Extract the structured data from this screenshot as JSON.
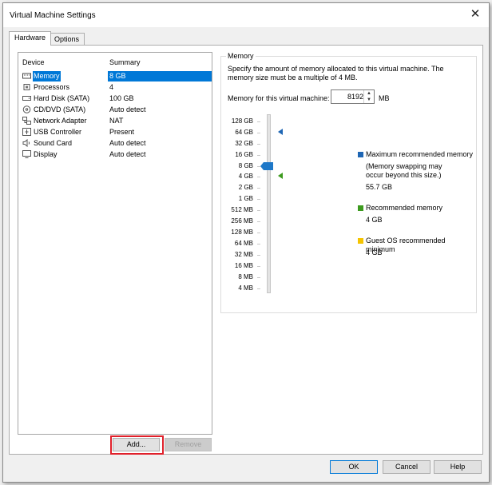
{
  "window": {
    "title": "Virtual Machine Settings",
    "close_glyph": "✕"
  },
  "tabs": [
    {
      "label": "Hardware"
    },
    {
      "label": "Options"
    }
  ],
  "device_list": {
    "headers": {
      "device": "Device",
      "summary": "Summary"
    },
    "rows": [
      {
        "icon": "memory-icon",
        "name": "Memory",
        "summary": "8 GB"
      },
      {
        "icon": "processor-icon",
        "name": "Processors",
        "summary": "4"
      },
      {
        "icon": "hard-disk-icon",
        "name": "Hard Disk (SATA)",
        "summary": "100 GB"
      },
      {
        "icon": "cd-dvd-icon",
        "name": "CD/DVD (SATA)",
        "summary": "Auto detect"
      },
      {
        "icon": "network-adapter-icon",
        "name": "Network Adapter",
        "summary": "NAT"
      },
      {
        "icon": "usb-controller-icon",
        "name": "USB Controller",
        "summary": "Present"
      },
      {
        "icon": "sound-card-icon",
        "name": "Sound Card",
        "summary": "Auto detect"
      },
      {
        "icon": "display-icon",
        "name": "Display",
        "summary": "Auto detect"
      }
    ]
  },
  "buttons": {
    "add": "Add...",
    "remove": "Remove",
    "ok": "OK",
    "cancel": "Cancel",
    "help": "Help"
  },
  "memory": {
    "group_label": "Memory",
    "description": "Specify the amount of memory allocated to this virtual machine. The memory size must be a multiple of 4 MB.",
    "field_label": "Memory for this virtual machine:",
    "value": "8192",
    "unit": "MB",
    "scale_labels": [
      "128 GB",
      "64 GB",
      "32 GB",
      "16 GB",
      "8 GB",
      "4 GB",
      "2 GB",
      "1 GB",
      "512 MB",
      "256 MB",
      "128 MB",
      "64 MB",
      "32 MB",
      "16 MB",
      "8 MB",
      "4 MB"
    ],
    "legend": {
      "max": {
        "title": "Maximum recommended memory",
        "note": "(Memory swapping may occur beyond this size.)",
        "value": "55.7 GB"
      },
      "recommended": {
        "title": "Recommended memory",
        "value": "4 GB"
      },
      "guest_min": {
        "title": "Guest OS recommended minimum",
        "value": "4 GB"
      }
    }
  },
  "colors": {
    "selection": "#0078d7",
    "max_marker": "#1e66b4",
    "recommended_marker": "#3c9a1e",
    "guest_min_marker": "#f5c400",
    "highlight": "#e0202a"
  }
}
